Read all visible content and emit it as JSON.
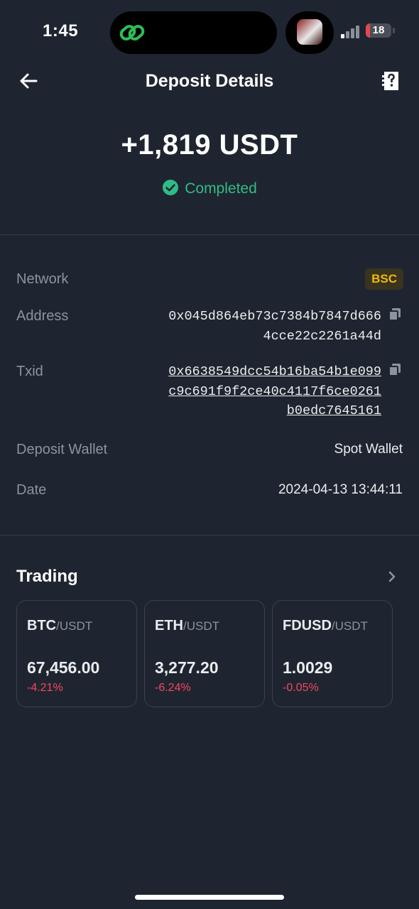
{
  "status_bar": {
    "time": "1:45",
    "battery": "18",
    "battery_percent": 18,
    "signal_bars_active": 1
  },
  "header": {
    "title": "Deposit Details"
  },
  "summary": {
    "amount": "+1,819 USDT",
    "status": "Completed"
  },
  "details": {
    "network_label": "Network",
    "network_value": "BSC",
    "address_label": "Address",
    "address_value": "0x045d864eb73c7384b7847d6664cce22c2261a44d",
    "txid_label": "Txid",
    "txid_value": "0x6638549dcc54b16ba54b1e099c9c691f9f2ce40c4117f6ce0261b0edc7645161",
    "wallet_label": "Deposit Wallet",
    "wallet_value": "Spot Wallet",
    "date_label": "Date",
    "date_value": "2024-04-13 13:44:11"
  },
  "trading": {
    "title": "Trading",
    "cards": [
      {
        "base": "BTC",
        "quote": "/USDT",
        "price": "67,456.00",
        "change": "-4.21%"
      },
      {
        "base": "ETH",
        "quote": "/USDT",
        "price": "3,277.20",
        "change": "-6.24%"
      },
      {
        "base": "FDUSD",
        "quote": "/USDT",
        "price": "1.0029",
        "change": "-0.05%"
      }
    ]
  },
  "colors": {
    "background": "#1f2530",
    "success": "#2ebd85",
    "negative": "#f6465d",
    "accent": "#f0b90b"
  },
  "icons": [
    "back-arrow-icon",
    "help-document-icon",
    "check-circle-icon",
    "copy-icon",
    "chevron-right-icon",
    "link-icon",
    "avatar"
  ]
}
